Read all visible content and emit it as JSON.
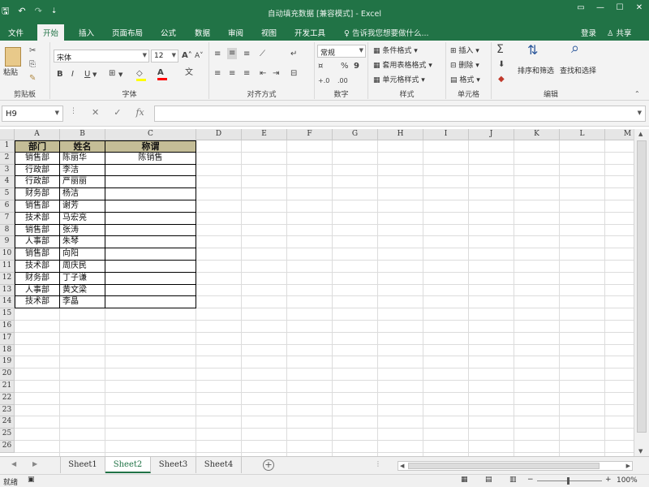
{
  "title": "自动填充数据 [兼容模式] - Excel",
  "qat": {
    "save": "🖫",
    "undo": "↶",
    "redo": "↷",
    "more": "⇣"
  },
  "window": {
    "restore": "▭",
    "minimize": "—",
    "maximize": "☐",
    "close": "✕"
  },
  "tabs": [
    "文件",
    "开始",
    "插入",
    "页面布局",
    "公式",
    "数据",
    "审阅",
    "视图",
    "开发工具"
  ],
  "active_tab": "开始",
  "tell_me": "告诉我您想要做什么...",
  "login": "登录",
  "share": "共享",
  "ribbon": {
    "clipboard": {
      "paste": "粘贴",
      "label": "剪贴板"
    },
    "font": {
      "name": "宋体",
      "size": "12",
      "bold": "B",
      "italic": "I",
      "underline": "U",
      "grow": "A",
      "shrink": "A",
      "color_letter": "A",
      "fill_color": "#ffff00",
      "font_color": "#ff0000",
      "label": "字体"
    },
    "alignment": {
      "label": "对齐方式"
    },
    "number": {
      "format": "常规",
      "percent": "%",
      "comma": "9",
      "label": "数字"
    },
    "styles": {
      "conditional": "条件格式",
      "table": "套用表格格式",
      "cell": "单元格样式",
      "label": "样式"
    },
    "cells": {
      "insert": "插入",
      "delete": "删除",
      "format": "格式",
      "label": "单元格"
    },
    "editing": {
      "sum": "Σ",
      "sort": "排序和筛选",
      "find": "查找和选择",
      "label": "编辑"
    }
  },
  "name_box": "H9",
  "formula": "",
  "columns": [
    "A",
    "B",
    "C",
    "D",
    "E",
    "F",
    "G",
    "H",
    "I",
    "J",
    "K",
    "L",
    "M"
  ],
  "rows": [
    "1",
    "2",
    "3",
    "4",
    "5",
    "6",
    "7",
    "8",
    "9",
    "10",
    "11",
    "12",
    "13",
    "14",
    "15",
    "16",
    "17",
    "18",
    "19",
    "20",
    "21",
    "22",
    "23",
    "24",
    "25",
    "26"
  ],
  "table": {
    "headers": [
      "部门",
      "姓名",
      "称谓"
    ],
    "header_fill": "#c4bd97",
    "data": [
      [
        "销售部",
        "陈丽华",
        "陈销售"
      ],
      [
        "行政部",
        "李洁",
        ""
      ],
      [
        "行政部",
        "严丽丽",
        ""
      ],
      [
        "财务部",
        "杨洁",
        ""
      ],
      [
        "销售部",
        "谢芳",
        ""
      ],
      [
        "技术部",
        "马宏亮",
        ""
      ],
      [
        "销售部",
        "张涛",
        ""
      ],
      [
        "人事部",
        "朱琴",
        ""
      ],
      [
        "销售部",
        "向阳",
        ""
      ],
      [
        "技术部",
        "周庆民",
        ""
      ],
      [
        "财务部",
        "丁子谦",
        ""
      ],
      [
        "人事部",
        "黄文梁",
        ""
      ],
      [
        "技术部",
        "李晶",
        ""
      ]
    ]
  },
  "sheets": [
    "Sheet1",
    "Sheet2",
    "Sheet3",
    "Sheet4"
  ],
  "active_sheet": "Sheet2",
  "status": {
    "mode": "就绪",
    "zoom": "100%"
  },
  "accent": "#217346"
}
